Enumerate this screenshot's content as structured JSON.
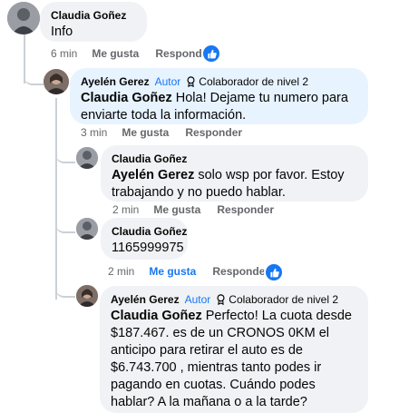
{
  "comments": [
    {
      "author": "Claudia Goñez",
      "text": "Info",
      "time": "6 min",
      "like": "Me gusta",
      "reply": "Responder",
      "liked": false
    },
    {
      "author": "Ayelén Gerez",
      "role": "Autor",
      "badge": "Colaborador de nivel 2",
      "mention": "Claudia Goñez",
      "text": " Hola! Dejame tu numero para enviarte toda la información.",
      "time": "3 min",
      "like": "Me gusta",
      "reply": "Responder",
      "liked": false
    },
    {
      "author": "Claudia Goñez",
      "mention": "Ayelén Gerez",
      "text": " solo wsp por favor. Estoy trabajando y no puedo hablar.",
      "time": "2 min",
      "like": "Me gusta",
      "reply": "Responder",
      "liked": false
    },
    {
      "author": "Claudia Goñez",
      "text": "1165999975",
      "time": "2 min",
      "like": "Me gusta",
      "reply": "Responder",
      "liked": true
    },
    {
      "author": "Ayelén Gerez",
      "role": "Autor",
      "badge": "Colaborador de nivel 2",
      "mention": "Claudia Goñez",
      "text": " Perfecto! La cuota desde $187.467. es de un CRONOS 0KM el anticipo para retirar el auto es de $6.743.700 , mientras tanto podes ir pagando en cuotas. Cuándo podes hablar? A la mañana o a la tarde?"
    }
  ],
  "icons": {
    "reaction": "like-thumb-icon",
    "badge": "award-ribbon-icon"
  },
  "colors": {
    "accent": "#1877f2",
    "bubble": "#f0f2f5",
    "bubble_highlight": "#e7f3ff",
    "meta": "#65676b"
  }
}
